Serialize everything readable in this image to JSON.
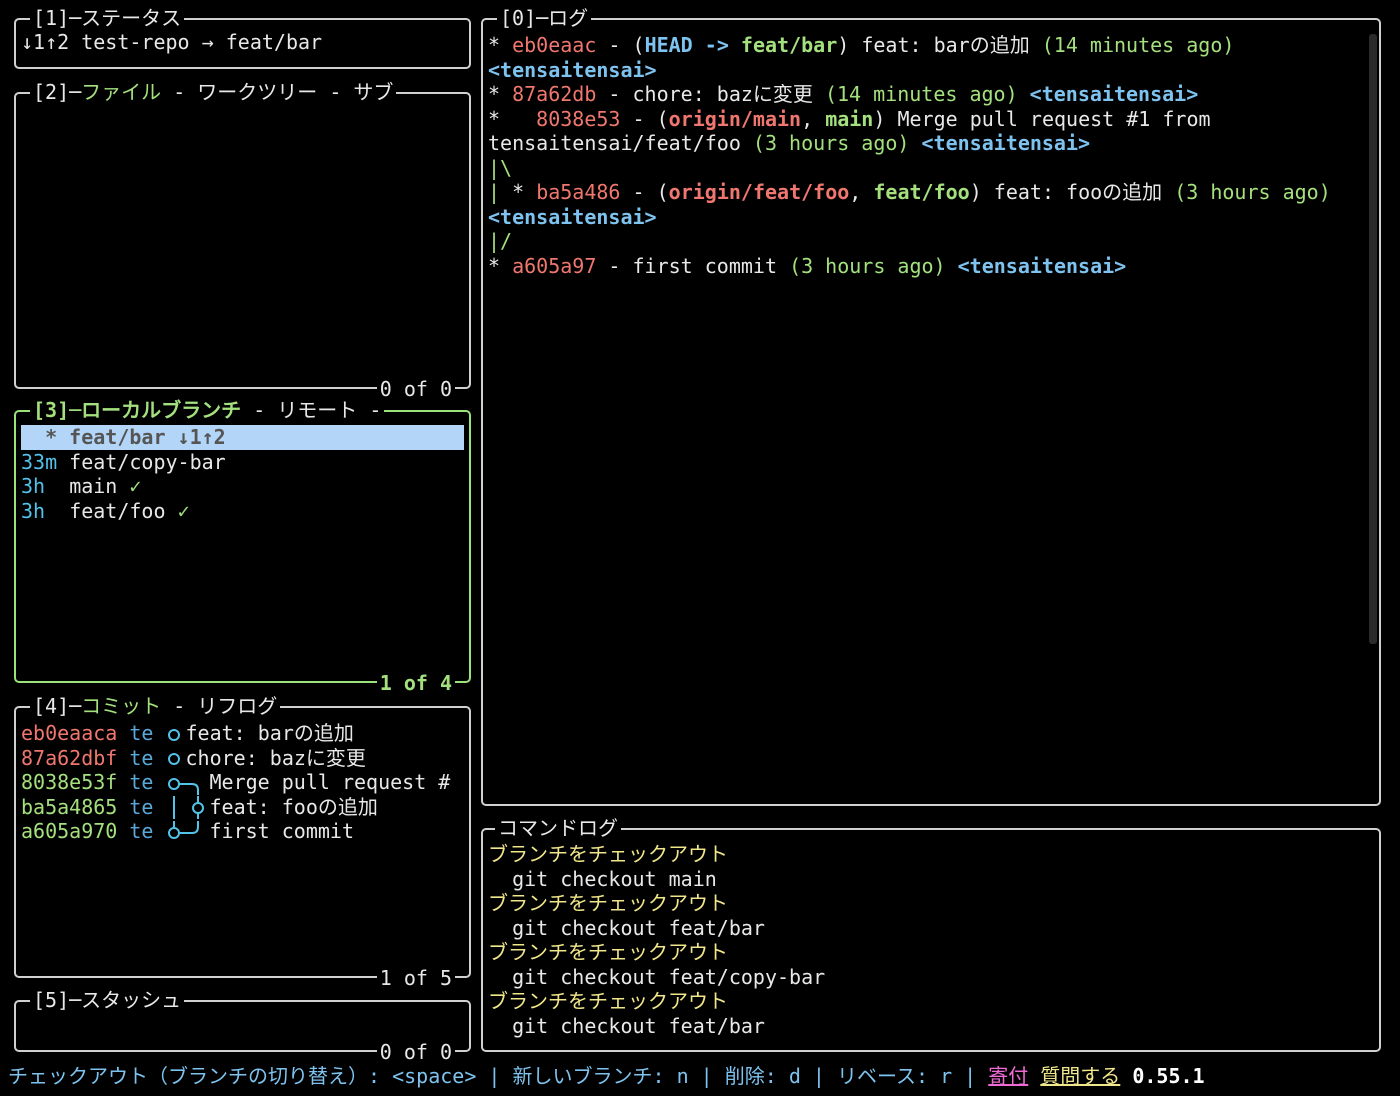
{
  "status_panel": {
    "title": "[1]─ステータス",
    "line": {
      "arrows": "↓1↑2",
      "repo": "test-repo",
      "arrow": "→",
      "branch": "feat/bar"
    }
  },
  "files_panel": {
    "title_num": "[2]─",
    "title_active": "ファイル",
    "title_rest": " - ワークツリー - サブ",
    "footer": "0 of 0"
  },
  "branches_panel": {
    "title_active": "[3]─ローカルブランチ",
    "title_rest": " - リモート -",
    "footer": "1 of 4",
    "items": [
      {
        "age": "  *",
        "name": "feat/bar",
        "extra": "↓1↑2"
      },
      {
        "age": "33m",
        "name": "feat/copy-bar",
        "extra": ""
      },
      {
        "age": "3h",
        "name": "main",
        "extra": "✓"
      },
      {
        "age": "3h",
        "name": "feat/foo",
        "extra": "✓"
      }
    ]
  },
  "commits_panel": {
    "title_num": "[4]─",
    "title_active": "コミット",
    "title_rest": " - リフログ",
    "footer": "1 of 5",
    "items": [
      {
        "hash": "eb0eaaca",
        "author": "te",
        "message": "feat: barの追加",
        "pushed": false
      },
      {
        "hash": "87a62dbf",
        "author": "te",
        "message": "chore: bazに変更",
        "pushed": false
      },
      {
        "hash": "8038e53f",
        "author": "te",
        "message": "Merge pull request #",
        "pushed": true
      },
      {
        "hash": "ba5a4865",
        "author": "te",
        "message": "feat: fooの追加",
        "pushed": true
      },
      {
        "hash": "a605a970",
        "author": "te",
        "message": "first commit",
        "pushed": true
      }
    ]
  },
  "stash_panel": {
    "title": "[5]─スタッシュ",
    "footer": "0 of 0"
  },
  "log_panel": {
    "title": "[0]─ログ",
    "lines": {
      "l1": {
        "star": "* ",
        "hash": "eb0eaac",
        "dash": " - (",
        "head": "HEAD",
        "arrow": " -> ",
        "branch": "feat/bar",
        "close": ") ",
        "msg": "feat: barの追加 ",
        "time": "(14 minutes ago)"
      },
      "l2": {
        "author": "<tensaitensai>"
      },
      "l3": {
        "star": "* ",
        "hash": "87a62db",
        "dash": " - ",
        "msg": "chore: bazに変更 ",
        "time": "(14 minutes ago) ",
        "author": "<tensaitensai>"
      },
      "l4": {
        "star": "*   ",
        "hash": "8038e53",
        "dash": " - (",
        "ref1": "origin/main",
        "comma": ", ",
        "ref2": "main",
        "close": ") ",
        "msg": "Merge pull request #1 from"
      },
      "l5": {
        "msg": "tensaitensai/feat/foo ",
        "time": "(3 hours ago) ",
        "author": "<tensaitensai>"
      },
      "l6": {
        "graph": "|\\"
      },
      "l7": {
        "graph": "| ",
        "star": "* ",
        "hash": "ba5a486",
        "dash": " - (",
        "ref1": "origin/feat/foo",
        "comma": ", ",
        "ref2": "feat/foo",
        "close": ") ",
        "msg": "feat: fooの追加 ",
        "time": "(3 hours ago)"
      },
      "l8": {
        "author": "<tensaitensai>"
      },
      "l9": {
        "graph": "|/"
      },
      "l10": {
        "star": "* ",
        "hash": "a605a97",
        "dash": " - ",
        "msg": "first commit ",
        "time": "(3 hours ago) ",
        "author": "<tensaitensai>"
      }
    }
  },
  "command_log_panel": {
    "title": "コマンドログ",
    "entries": [
      {
        "label": "ブランチをチェックアウト",
        "command": "  git checkout main"
      },
      {
        "label": "ブランチをチェックアウト",
        "command": "  git checkout feat/bar"
      },
      {
        "label": "ブランチをチェックアウト",
        "command": "  git checkout feat/copy-bar"
      },
      {
        "label": "ブランチをチェックアウト",
        "command": "  git checkout feat/bar"
      }
    ]
  },
  "status_bar": {
    "checkout": "チェックアウト（ブランチの切り替え）: <space>",
    "sep": " | ",
    "new_branch": "新しいブランチ: n",
    "delete": "削除: d",
    "rebase": "リベース: r",
    "donate": "寄付",
    "ask": "質問する",
    "version": "0.55.1"
  },
  "colors": {
    "accent_green": "#a4e07e",
    "selection_bg": "#b3d6f8",
    "hash_red": "#f0776f",
    "author_blue": "#7ec3ef",
    "label_yellow": "#f0e68a"
  }
}
